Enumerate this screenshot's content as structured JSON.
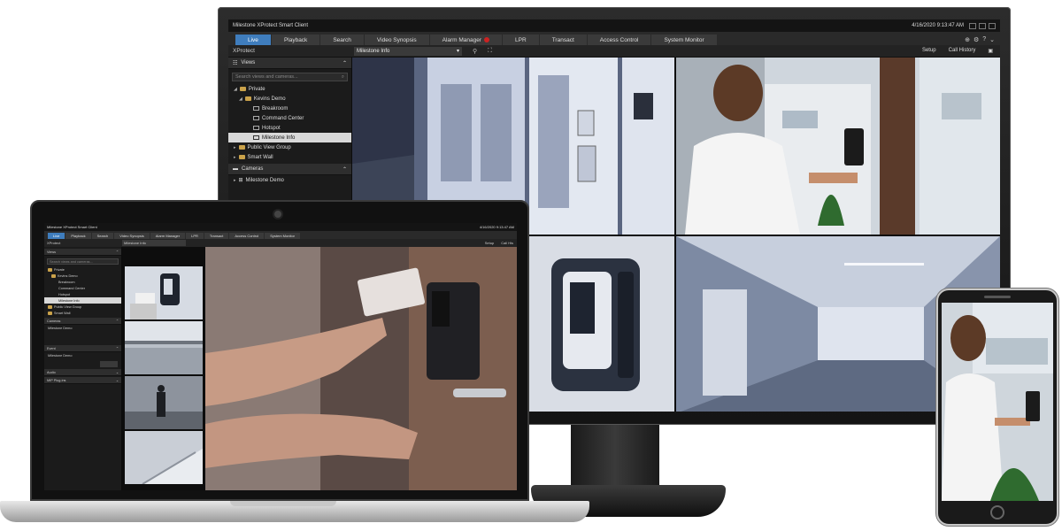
{
  "monitor": {
    "title": "Milestone XProtect Smart Client",
    "datetime": "4/16/2020 9:13:47 AM",
    "tabs": [
      {
        "label": "Live",
        "active": true
      },
      {
        "label": "Playback"
      },
      {
        "label": "Search"
      },
      {
        "label": "Video Synopsis"
      },
      {
        "label": "Alarm Manager",
        "alarm_badge": true
      },
      {
        "label": "LPR"
      },
      {
        "label": "Transact"
      },
      {
        "label": "Access Control"
      },
      {
        "label": "System Monitor"
      }
    ],
    "brand": "XProtect",
    "view_select": "Milestone Info",
    "setup_label": "Setup",
    "call_history_label": "Call History",
    "views_header": "Views",
    "search_placeholder": "Search views and cameras...",
    "tree": {
      "private": "Private",
      "kevins_demo": "Kevins Demo",
      "breakroom": "Breakroom",
      "command_center": "Command Center",
      "hotspot": "Hotspot",
      "milestone_info": "Milestone Info",
      "public_view_group": "Public View Group",
      "smart_wall": "Smart Wall"
    },
    "cameras_header": "Cameras",
    "cameras_item": "Milestone Demo"
  },
  "laptop": {
    "title": "Milestone XProtect Smart Client",
    "datetime": "4/16/2020 9:13:47 AM",
    "tabs": [
      {
        "label": "Live",
        "active": true
      },
      {
        "label": "Playback"
      },
      {
        "label": "Search"
      },
      {
        "label": "Video Synopsis"
      },
      {
        "label": "Alarm Manager"
      },
      {
        "label": "LPR"
      },
      {
        "label": "Transact"
      },
      {
        "label": "Access Control"
      },
      {
        "label": "System Monitor"
      }
    ],
    "brand": "XProtect",
    "view_select": "Milestone Info",
    "setup_label": "Setup",
    "call_label": "Call His",
    "views_header": "Views",
    "search_placeholder": "Search views and cameras...",
    "tree": {
      "private": "Private",
      "kevins_demo": "Kevins Demo",
      "breakroom": "Breakroom",
      "command_center": "Command Center",
      "hotspot": "Hotspot",
      "milestone_info": "Milestone Info",
      "public_view_group": "Public View Group",
      "smart_wall": "Smart Wall"
    },
    "cameras_header": "Cameras",
    "cameras_item": "Milestone Demo",
    "event_header": "Event",
    "event_item": "Milestone Demo",
    "audio_header": "Audio",
    "audio_item": "MIP Plug-ins"
  },
  "colors": {
    "accent": "#3f7dbd",
    "alarm": "#cc2222",
    "panel": "#1b1b1b"
  }
}
